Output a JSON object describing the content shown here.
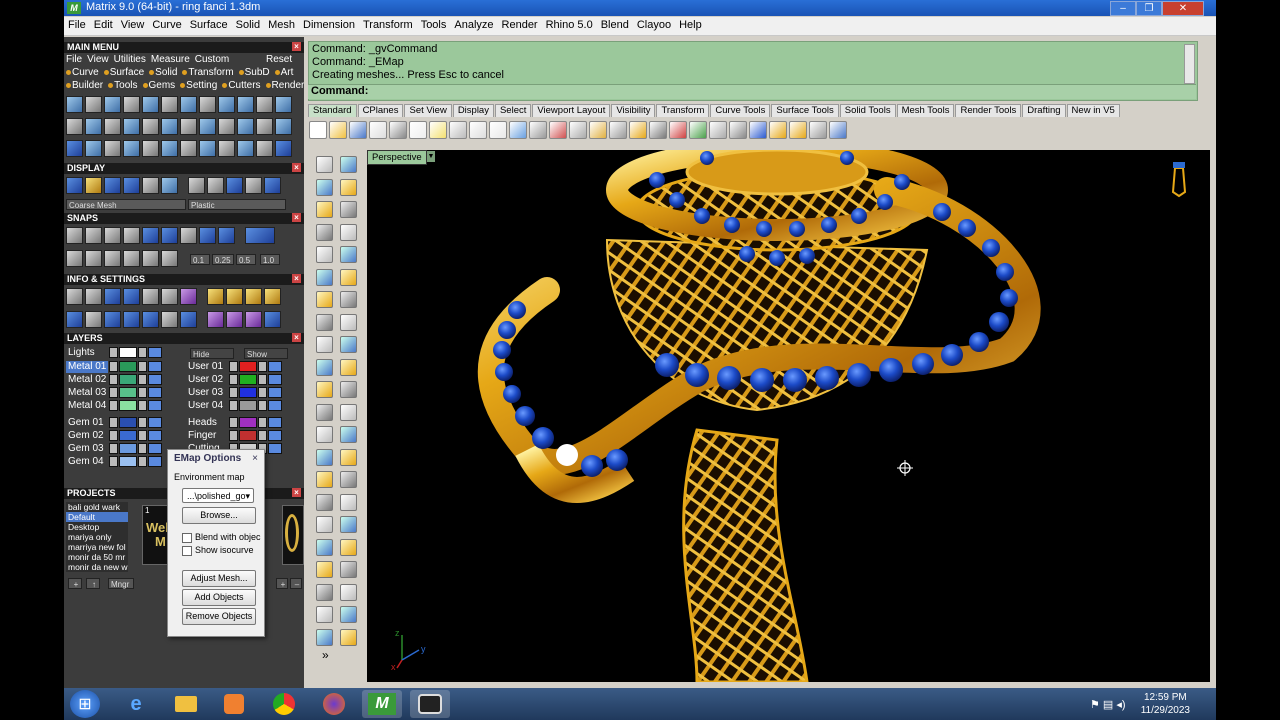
{
  "window": {
    "title": "Matrix 9.0 (64-bit) - ring fanci 1.3dm",
    "logo": "M",
    "controls": [
      "–",
      "❐",
      "✕"
    ]
  },
  "menubar": [
    "File",
    "Edit",
    "View",
    "Curve",
    "Surface",
    "Solid",
    "Mesh",
    "Dimension",
    "Transform",
    "Tools",
    "Analyze",
    "Render",
    "Rhino 5.0",
    "Blend",
    "Clayoo",
    "Help"
  ],
  "main_menu": {
    "header": "MAIN MENU",
    "row1": [
      "File",
      "View",
      "Utilities",
      "Measure",
      "Custom"
    ],
    "reset": "Reset",
    "row2": [
      "Curve",
      "Surface",
      "Solid",
      "Transform",
      "SubD",
      "Art"
    ],
    "row3": [
      "Builder",
      "Tools",
      "Gems",
      "Setting",
      "Cutters",
      "Render"
    ]
  },
  "display": {
    "header": "DISPLAY",
    "mesh_field": "Coarse Mesh",
    "material_field": "Plastic"
  },
  "snaps": {
    "header": "SNAPS",
    "values": [
      "0.1",
      "0.25",
      "0.5",
      "1.0"
    ]
  },
  "info": {
    "header": "INFO & SETTINGS"
  },
  "layers": {
    "header": "LAYERS",
    "lights": "Lights",
    "hide": "Hide",
    "show": "Show",
    "left": [
      {
        "name": "Metal 01",
        "color": "#2a9a5a",
        "selected": true
      },
      {
        "name": "Metal 02",
        "color": "#3aa878",
        "selected": false
      },
      {
        "name": "Metal 03",
        "color": "#58c08a",
        "selected": false
      },
      {
        "name": "Metal 04",
        "color": "#8ae0a0",
        "selected": false
      },
      {
        "name": "Gem 01",
        "color": "#2a4fb0",
        "selected": false
      },
      {
        "name": "Gem 02",
        "color": "#3a6ad0",
        "selected": false
      },
      {
        "name": "Gem 03",
        "color": "#6a9ae0",
        "selected": false
      },
      {
        "name": "Gem 04",
        "color": "#9ac0f0",
        "selected": false
      }
    ],
    "right": [
      {
        "name": "User 01",
        "color": "#e02020"
      },
      {
        "name": "User 02",
        "color": "#20b020"
      },
      {
        "name": "User 03",
        "color": "#2030e0"
      },
      {
        "name": "User 04",
        "color": "#9a9a9a"
      },
      {
        "name": "Heads",
        "color": "#a030c0"
      },
      {
        "name": "Finger",
        "color": "#c03030"
      },
      {
        "name": "Cutting",
        "color": "#d0d0d0"
      }
    ]
  },
  "projects": {
    "header": "PROJECTS",
    "items": [
      "bali gold wark",
      "Default",
      "Desktop",
      "mariya only",
      "marriya new fol",
      "monir da 50 mr",
      "monir da new w"
    ],
    "selected_index": 1,
    "thumb_number": "1",
    "thumb_text_1": "Welc",
    "thumb_text_2": "M",
    "buttons": [
      "+",
      "↑",
      "Mngr"
    ]
  },
  "emap": {
    "title": "EMap Options",
    "close": "×",
    "env_label": "Environment map",
    "dropdown": "...\\polished_go",
    "browse": "Browse...",
    "blend": "Blend with objec",
    "isocurve": "Show isocurve",
    "adjust": "Adjust Mesh...",
    "add": "Add Objects",
    "remove": "Remove Objects"
  },
  "command": {
    "lines": [
      "Command: _gvCommand",
      "Command: _EMap",
      "Creating meshes... Press Esc to cancel"
    ],
    "prompt": "Command:"
  },
  "tabs": [
    "Standard",
    "CPlanes",
    "Set View",
    "Display",
    "Select",
    "Viewport Layout",
    "Visibility",
    "Transform",
    "Curve Tools",
    "Surface Tools",
    "Solid Tools",
    "Mesh Tools",
    "Render Tools",
    "Drafting",
    "New in V5"
  ],
  "active_tab": 0,
  "viewport": {
    "label": "Perspective",
    "axis_z": "z",
    "axis_y": "y",
    "axis_x": "x"
  },
  "vtool_more": "»",
  "taskbar": {
    "time": "12:59 PM",
    "date": "11/29/2023",
    "apps": [
      "start-button",
      "ie",
      "explorer",
      "media",
      "chrome",
      "firefox",
      "matrix",
      "recorder"
    ]
  },
  "colors": {
    "gold": "#e6a817",
    "gem_blue": "#1c4bc8",
    "command_bg": "#9bc89b"
  }
}
